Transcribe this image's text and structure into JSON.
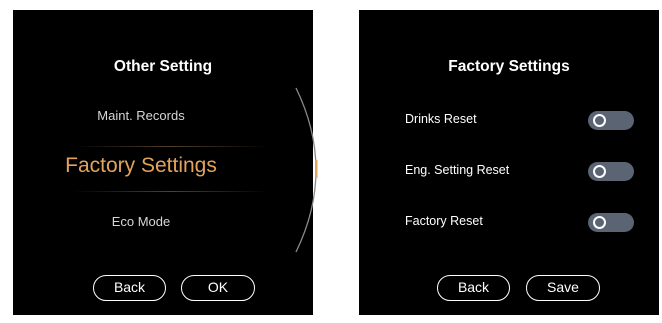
{
  "left_screen": {
    "title": "Other Setting",
    "menu_items": [
      {
        "label": "Maint. Records",
        "selected": false
      },
      {
        "label": "Factory Settings",
        "selected": true
      },
      {
        "label": "Eco Mode",
        "selected": false
      }
    ],
    "buttons": {
      "back": "Back",
      "ok": "OK"
    }
  },
  "right_screen": {
    "title": "Factory Settings",
    "rows": [
      {
        "label": "Drinks Reset",
        "toggle_on": false
      },
      {
        "label": "Eng. Setting Reset",
        "toggle_on": false
      },
      {
        "label": "Factory Reset",
        "toggle_on": false
      }
    ],
    "buttons": {
      "back": "Back",
      "save": "Save"
    }
  },
  "colors": {
    "screen_background": "#000000",
    "selected_item": "#e3a35c",
    "toggle_track": "#5a6473",
    "scroll_indicator": "#e3a35c"
  }
}
